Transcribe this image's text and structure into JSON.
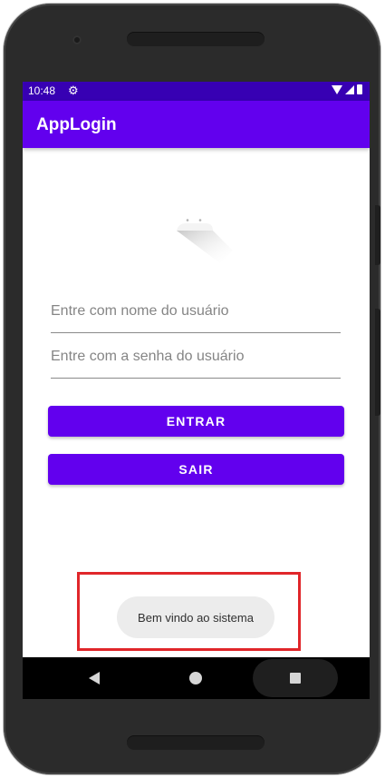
{
  "status_bar": {
    "time": "10:48",
    "icons": [
      "gear-icon",
      "wifi-icon",
      "signal-icon",
      "battery-icon"
    ]
  },
  "app_bar": {
    "title": "AppLogin"
  },
  "form": {
    "username_placeholder": "Entre com nome do usuário",
    "username_value": "",
    "password_placeholder": "Entre com a senha do usuário",
    "password_value": "",
    "enter_label": "ENTRAR",
    "exit_label": "SAIR"
  },
  "toast": {
    "message": "Bem vindo ao sistema"
  },
  "nav": {
    "icons": [
      "back-icon",
      "home-icon",
      "recent-apps-icon"
    ]
  },
  "colors": {
    "primary": "#6200ee",
    "primary_dark": "#3700b3",
    "highlight": "#e0262a"
  }
}
